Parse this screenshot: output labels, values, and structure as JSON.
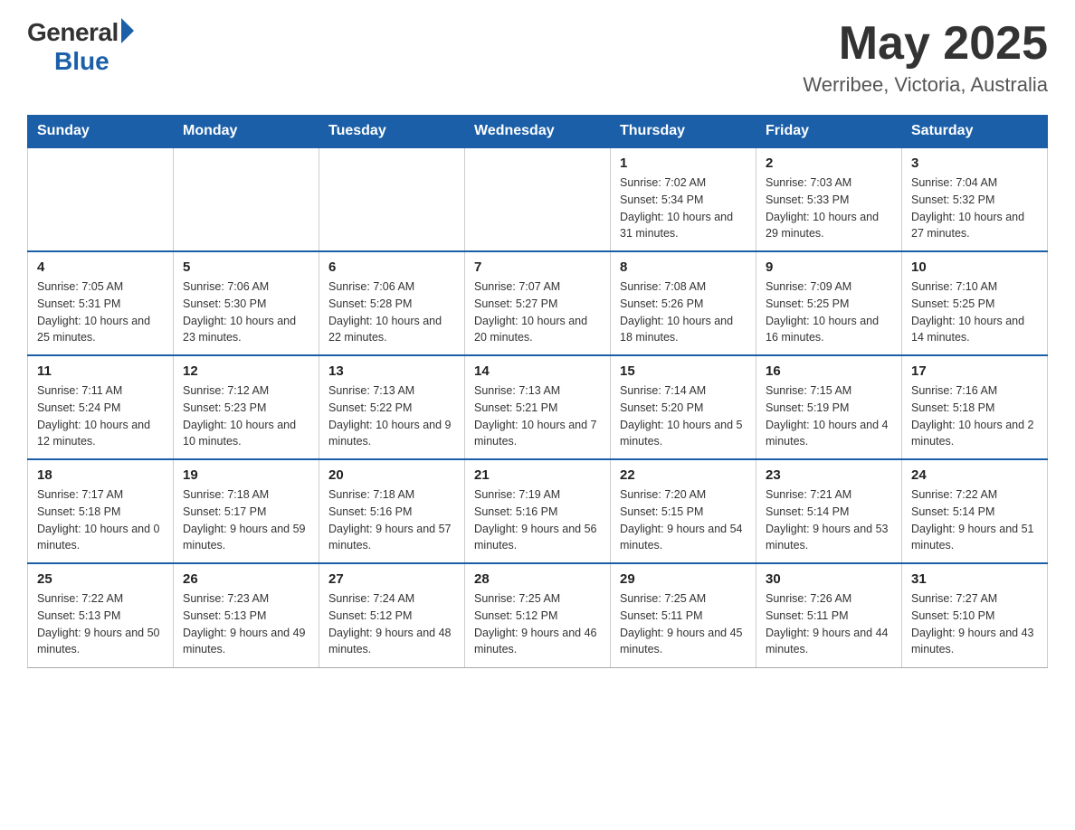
{
  "header": {
    "logo_general": "General",
    "logo_blue": "Blue",
    "month_title": "May 2025",
    "location": "Werribee, Victoria, Australia"
  },
  "days_of_week": [
    "Sunday",
    "Monday",
    "Tuesday",
    "Wednesday",
    "Thursday",
    "Friday",
    "Saturday"
  ],
  "weeks": [
    [
      {
        "day": "",
        "info": ""
      },
      {
        "day": "",
        "info": ""
      },
      {
        "day": "",
        "info": ""
      },
      {
        "day": "",
        "info": ""
      },
      {
        "day": "1",
        "info": "Sunrise: 7:02 AM\nSunset: 5:34 PM\nDaylight: 10 hours and 31 minutes."
      },
      {
        "day": "2",
        "info": "Sunrise: 7:03 AM\nSunset: 5:33 PM\nDaylight: 10 hours and 29 minutes."
      },
      {
        "day": "3",
        "info": "Sunrise: 7:04 AM\nSunset: 5:32 PM\nDaylight: 10 hours and 27 minutes."
      }
    ],
    [
      {
        "day": "4",
        "info": "Sunrise: 7:05 AM\nSunset: 5:31 PM\nDaylight: 10 hours and 25 minutes."
      },
      {
        "day": "5",
        "info": "Sunrise: 7:06 AM\nSunset: 5:30 PM\nDaylight: 10 hours and 23 minutes."
      },
      {
        "day": "6",
        "info": "Sunrise: 7:06 AM\nSunset: 5:28 PM\nDaylight: 10 hours and 22 minutes."
      },
      {
        "day": "7",
        "info": "Sunrise: 7:07 AM\nSunset: 5:27 PM\nDaylight: 10 hours and 20 minutes."
      },
      {
        "day": "8",
        "info": "Sunrise: 7:08 AM\nSunset: 5:26 PM\nDaylight: 10 hours and 18 minutes."
      },
      {
        "day": "9",
        "info": "Sunrise: 7:09 AM\nSunset: 5:25 PM\nDaylight: 10 hours and 16 minutes."
      },
      {
        "day": "10",
        "info": "Sunrise: 7:10 AM\nSunset: 5:25 PM\nDaylight: 10 hours and 14 minutes."
      }
    ],
    [
      {
        "day": "11",
        "info": "Sunrise: 7:11 AM\nSunset: 5:24 PM\nDaylight: 10 hours and 12 minutes."
      },
      {
        "day": "12",
        "info": "Sunrise: 7:12 AM\nSunset: 5:23 PM\nDaylight: 10 hours and 10 minutes."
      },
      {
        "day": "13",
        "info": "Sunrise: 7:13 AM\nSunset: 5:22 PM\nDaylight: 10 hours and 9 minutes."
      },
      {
        "day": "14",
        "info": "Sunrise: 7:13 AM\nSunset: 5:21 PM\nDaylight: 10 hours and 7 minutes."
      },
      {
        "day": "15",
        "info": "Sunrise: 7:14 AM\nSunset: 5:20 PM\nDaylight: 10 hours and 5 minutes."
      },
      {
        "day": "16",
        "info": "Sunrise: 7:15 AM\nSunset: 5:19 PM\nDaylight: 10 hours and 4 minutes."
      },
      {
        "day": "17",
        "info": "Sunrise: 7:16 AM\nSunset: 5:18 PM\nDaylight: 10 hours and 2 minutes."
      }
    ],
    [
      {
        "day": "18",
        "info": "Sunrise: 7:17 AM\nSunset: 5:18 PM\nDaylight: 10 hours and 0 minutes."
      },
      {
        "day": "19",
        "info": "Sunrise: 7:18 AM\nSunset: 5:17 PM\nDaylight: 9 hours and 59 minutes."
      },
      {
        "day": "20",
        "info": "Sunrise: 7:18 AM\nSunset: 5:16 PM\nDaylight: 9 hours and 57 minutes."
      },
      {
        "day": "21",
        "info": "Sunrise: 7:19 AM\nSunset: 5:16 PM\nDaylight: 9 hours and 56 minutes."
      },
      {
        "day": "22",
        "info": "Sunrise: 7:20 AM\nSunset: 5:15 PM\nDaylight: 9 hours and 54 minutes."
      },
      {
        "day": "23",
        "info": "Sunrise: 7:21 AM\nSunset: 5:14 PM\nDaylight: 9 hours and 53 minutes."
      },
      {
        "day": "24",
        "info": "Sunrise: 7:22 AM\nSunset: 5:14 PM\nDaylight: 9 hours and 51 minutes."
      }
    ],
    [
      {
        "day": "25",
        "info": "Sunrise: 7:22 AM\nSunset: 5:13 PM\nDaylight: 9 hours and 50 minutes."
      },
      {
        "day": "26",
        "info": "Sunrise: 7:23 AM\nSunset: 5:13 PM\nDaylight: 9 hours and 49 minutes."
      },
      {
        "day": "27",
        "info": "Sunrise: 7:24 AM\nSunset: 5:12 PM\nDaylight: 9 hours and 48 minutes."
      },
      {
        "day": "28",
        "info": "Sunrise: 7:25 AM\nSunset: 5:12 PM\nDaylight: 9 hours and 46 minutes."
      },
      {
        "day": "29",
        "info": "Sunrise: 7:25 AM\nSunset: 5:11 PM\nDaylight: 9 hours and 45 minutes."
      },
      {
        "day": "30",
        "info": "Sunrise: 7:26 AM\nSunset: 5:11 PM\nDaylight: 9 hours and 44 minutes."
      },
      {
        "day": "31",
        "info": "Sunrise: 7:27 AM\nSunset: 5:10 PM\nDaylight: 9 hours and 43 minutes."
      }
    ]
  ]
}
